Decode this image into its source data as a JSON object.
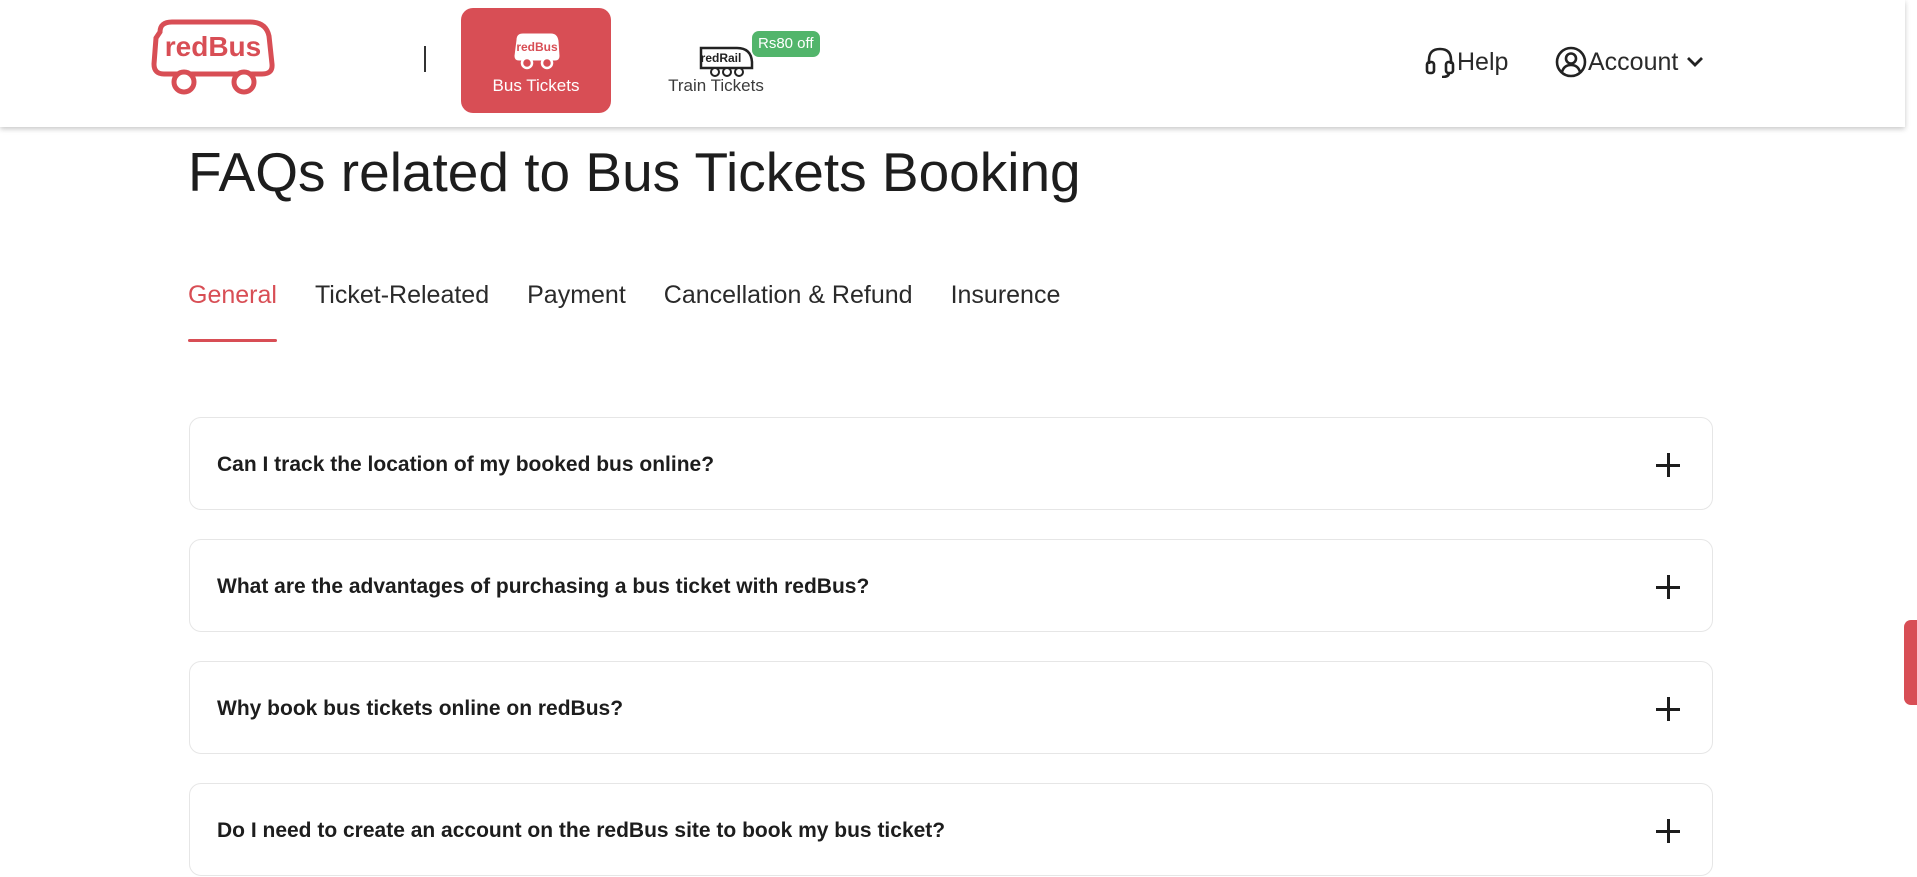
{
  "header": {
    "logo_text": "redBus",
    "divider": "|",
    "nav": {
      "bus_label": "Bus Tickets",
      "bus_icon_text": "redBus",
      "train_label": "Train Tickets",
      "train_icon_text": "redRail",
      "train_offer": "Rs80 off"
    },
    "help_label": "Help",
    "account_label": "Account",
    "icons": {
      "logo": "redbus-logo",
      "bus": "bus-icon",
      "train": "train-icon",
      "help": "headset-icon",
      "account": "user-circle-icon",
      "dropdown": "chevron-down-icon"
    }
  },
  "main": {
    "title": "FAQs related to Bus Tickets Booking",
    "tabs": [
      {
        "label": "General",
        "active": true
      },
      {
        "label": "Ticket-Releated",
        "active": false
      },
      {
        "label": "Payment",
        "active": false
      },
      {
        "label": "Cancellation & Refund",
        "active": false
      },
      {
        "label": "Insurence",
        "active": false
      }
    ],
    "faqs": [
      {
        "question": "Can I track the location of my booked bus online?"
      },
      {
        "question": "What are the advantages of purchasing a bus ticket with redBus?"
      },
      {
        "question": "Why book bus tickets online on redBus?"
      },
      {
        "question": "Do I need to create an account on the redBus site to book my bus ticket?"
      }
    ]
  },
  "colors": {
    "brand_red": "#d84e55",
    "offer_green": "#52b56b",
    "text_dark": "#1d1d1d",
    "border": "#e6e6e6"
  }
}
